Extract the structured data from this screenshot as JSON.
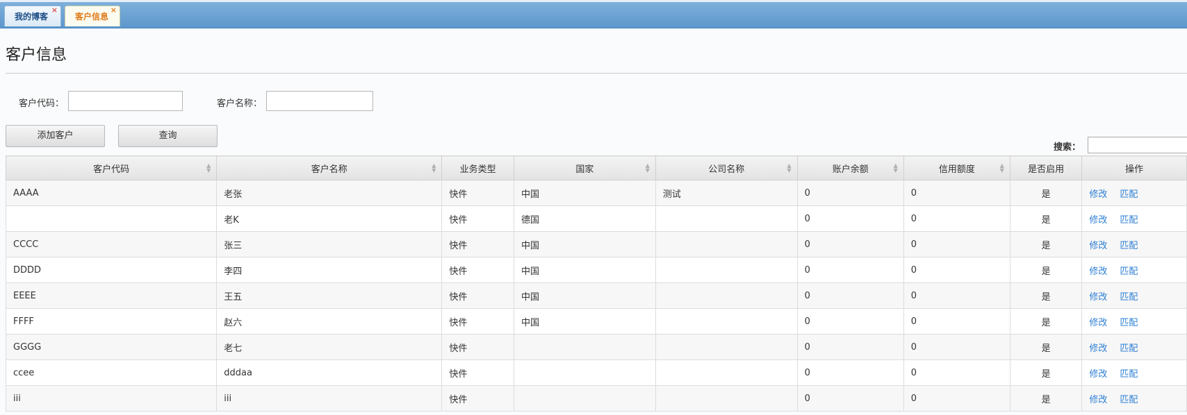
{
  "tabs": [
    {
      "label": "我的博客",
      "close": "×"
    },
    {
      "label": "客户信息",
      "close": "×"
    }
  ],
  "page": {
    "title": "客户信息",
    "filters": {
      "code_label": "客户代码：",
      "code_value": "",
      "name_label": "客户名称：",
      "name_value": ""
    },
    "buttons": {
      "add": "添加客户",
      "query": "查询"
    },
    "search_label": "搜索："
  },
  "table": {
    "columns": [
      "客户代码",
      "客户名称",
      "业务类型",
      "国家",
      "公司名称",
      "账户余额",
      "信用额度",
      "是否启用",
      "操作"
    ],
    "ops": {
      "edit": "修改",
      "match": "匹配"
    },
    "rows": [
      {
        "code": "AAAA",
        "name": "老张",
        "type": "快件",
        "country": "中国",
        "company": "测试",
        "balance": "0",
        "credit": "0",
        "enabled": "是"
      },
      {
        "code": "",
        "name": "老K",
        "type": "快件",
        "country": "德国",
        "company": "",
        "balance": "0",
        "credit": "0",
        "enabled": "是"
      },
      {
        "code": "CCCC",
        "name": "张三",
        "type": "快件",
        "country": "中国",
        "company": "",
        "balance": "0",
        "credit": "0",
        "enabled": "是"
      },
      {
        "code": "DDDD",
        "name": "李四",
        "type": "快件",
        "country": "中国",
        "company": "",
        "balance": "0",
        "credit": "0",
        "enabled": "是"
      },
      {
        "code": "EEEE",
        "name": "王五",
        "type": "快件",
        "country": "中国",
        "company": "",
        "balance": "0",
        "credit": "0",
        "enabled": "是"
      },
      {
        "code": "FFFF",
        "name": "赵六",
        "type": "快件",
        "country": "中国",
        "company": "",
        "balance": "0",
        "credit": "0",
        "enabled": "是"
      },
      {
        "code": "GGGG",
        "name": "老七",
        "type": "快件",
        "country": "",
        "company": "",
        "balance": "0",
        "credit": "0",
        "enabled": "是"
      },
      {
        "code": "ccee",
        "name": "dddaa",
        "type": "快件",
        "country": "",
        "company": "",
        "balance": "0",
        "credit": "0",
        "enabled": "是"
      },
      {
        "code": "iii",
        "name": "iii",
        "type": "快件",
        "country": "",
        "company": "",
        "balance": "0",
        "credit": "0",
        "enabled": "是"
      }
    ]
  }
}
